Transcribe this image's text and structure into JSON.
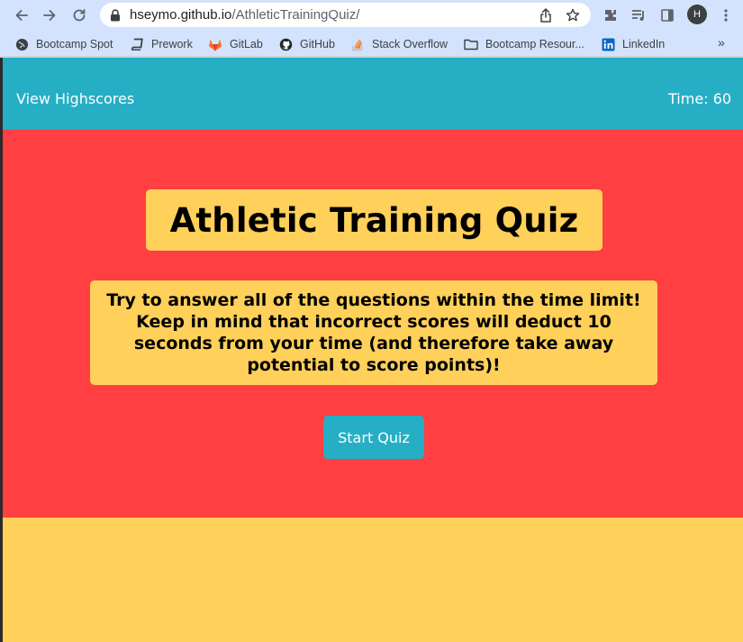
{
  "browser": {
    "url_host": "hseymo.github.io",
    "url_path": "/AthleticTrainingQuiz/",
    "profile_initial": "H",
    "bookmarks": [
      {
        "label": "Bootcamp Spot",
        "icon": "globe-icon"
      },
      {
        "label": "Prework",
        "icon": "book-icon"
      },
      {
        "label": "GitLab",
        "icon": "gitlab-icon"
      },
      {
        "label": "GitHub",
        "icon": "github-icon"
      },
      {
        "label": "Stack Overflow",
        "icon": "stackoverflow-icon"
      },
      {
        "label": "Bootcamp Resour...",
        "icon": "folder-icon"
      },
      {
        "label": "LinkedIn",
        "icon": "linkedin-icon"
      }
    ],
    "more_bookmarks": "»"
  },
  "header": {
    "highscores_label": "View Highscores",
    "timer_text": "Time: 60"
  },
  "main": {
    "title": "Athletic Training Quiz",
    "intro": "Try to answer all of the questions within the time limit! Keep in mind that incorrect scores will deduct 10 seconds from your time (and therefore take away potential to score points)!",
    "start_label": "Start Quiz"
  },
  "colors": {
    "header": "#26aec4",
    "hero": "#ff3f42",
    "card": "#ffd05a",
    "button": "#26aec4"
  }
}
